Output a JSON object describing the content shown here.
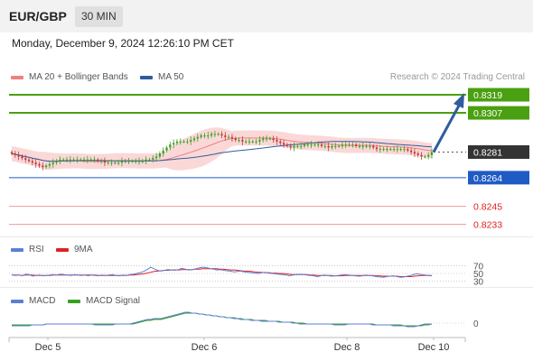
{
  "header": {
    "symbol": "EUR/GBP",
    "timeframe": "30 MIN",
    "datetime": "Monday, December 9, 2024 12:26:10 PM CET",
    "credit": "Research © 2024 Trading Central"
  },
  "legends": {
    "price": [
      {
        "name": "MA 20 + Bollinger Bands",
        "color": "#f08080"
      },
      {
        "name": "MA 50",
        "color": "#2f5d9e"
      }
    ],
    "rsi": [
      {
        "name": "RSI",
        "color": "#5b7fd6"
      },
      {
        "name": "9MA",
        "color": "#e02020"
      }
    ],
    "macd": [
      {
        "name": "MACD",
        "color": "#5b7fd6"
      },
      {
        "name": "MACD Signal",
        "color": "#3aa020"
      }
    ]
  },
  "colors": {
    "bull": "#3aa020",
    "bear": "#c23a3a",
    "band": "#f8c8c8",
    "target_line": "#4aa010",
    "support_line": "#1f5bc4",
    "support2_line": "#f09a9a",
    "current": "#333333",
    "arrow": "#2f5d9e"
  },
  "chart_data": [
    {
      "type": "candlestick",
      "title": "EUR/GBP 30 MIN",
      "x_labels": [
        "Dec 5",
        "Dec 6",
        "Dec 8",
        "Dec 10"
      ],
      "ylim": [
        0.8225,
        0.8325
      ],
      "closes": [
        0.828,
        0.8279,
        0.8278,
        0.8277,
        0.8276,
        0.8275,
        0.8274,
        0.8273,
        0.8272,
        0.8271,
        0.8272,
        0.8273,
        0.8274,
        0.8275,
        0.8276,
        0.8276,
        0.8276,
        0.8276,
        0.8276,
        0.8276,
        0.8276,
        0.8276,
        0.8276,
        0.8276,
        0.8276,
        0.8275,
        0.8275,
        0.8274,
        0.8274,
        0.8274,
        0.8274,
        0.8274,
        0.8275,
        0.8275,
        0.8275,
        0.8275,
        0.8275,
        0.8275,
        0.8275,
        0.8276,
        0.8276,
        0.8277,
        0.8278,
        0.828,
        0.8282,
        0.8284,
        0.8286,
        0.8287,
        0.8288,
        0.8288,
        0.8288,
        0.8288,
        0.8289,
        0.829,
        0.8291,
        0.8292,
        0.8292,
        0.8292,
        0.8293,
        0.8293,
        0.8293,
        0.8292,
        0.8291,
        0.8291,
        0.829,
        0.8289,
        0.8289,
        0.8288,
        0.8288,
        0.8288,
        0.8288,
        0.8288,
        0.8289,
        0.829,
        0.829,
        0.829,
        0.8289,
        0.8288,
        0.8287,
        0.8286,
        0.8285,
        0.8284,
        0.8285,
        0.8285,
        0.8285,
        0.8286,
        0.8286,
        0.8286,
        0.8286,
        0.8286,
        0.8285,
        0.8285,
        0.8284,
        0.8285,
        0.8285,
        0.8285,
        0.8286,
        0.8286,
        0.8286,
        0.8286,
        0.8285,
        0.8285,
        0.8285,
        0.8285,
        0.8285,
        0.8284,
        0.8283,
        0.8283,
        0.8283,
        0.8283,
        0.8283,
        0.8283,
        0.8283,
        0.8283,
        0.8283,
        0.8282,
        0.8281,
        0.828,
        0.8279,
        0.8278,
        0.8278,
        0.8279,
        0.8281
      ],
      "levels": [
        {
          "label": "0.8319",
          "value": 0.8319,
          "kind": "target"
        },
        {
          "label": "0.8307",
          "value": 0.8307,
          "kind": "target"
        },
        {
          "label": "0.8281",
          "value": 0.8281,
          "kind": "current"
        },
        {
          "label": "0.8264",
          "value": 0.8264,
          "kind": "support"
        },
        {
          "label": "0.8245",
          "value": 0.8245,
          "kind": "support2"
        },
        {
          "label": "0.8233",
          "value": 0.8233,
          "kind": "support2"
        }
      ]
    },
    {
      "type": "line",
      "name": "RSI",
      "ticks": [
        "70",
        "50",
        "30"
      ],
      "ylim": [
        20,
        80
      ],
      "rsi": [
        47,
        45,
        46,
        44,
        48,
        47,
        43,
        45,
        46,
        44,
        45,
        46,
        47,
        46,
        48,
        47,
        46,
        45,
        47,
        46,
        45,
        46,
        44,
        46,
        45,
        44,
        46,
        45,
        46,
        47,
        45,
        44,
        46,
        45,
        47,
        48,
        50,
        52,
        55,
        60,
        66,
        62,
        58,
        56,
        58,
        60,
        59,
        58,
        60,
        63,
        61,
        59,
        60,
        62,
        64,
        66,
        65,
        63,
        61,
        59,
        60,
        58,
        57,
        56,
        54,
        55,
        56,
        54,
        53,
        52,
        51,
        50,
        52,
        53,
        51,
        50,
        49,
        48,
        47,
        46,
        44,
        46,
        47,
        48,
        47,
        46,
        45,
        44,
        42,
        44,
        46,
        45,
        43,
        44,
        45,
        46,
        47,
        46,
        45,
        44,
        43,
        44,
        46,
        45,
        44,
        42,
        41,
        40,
        42,
        43,
        44,
        42,
        40,
        41,
        43,
        45,
        48,
        49,
        47,
        46,
        45,
        44
      ],
      "ma9": [
        46,
        46,
        46,
        45,
        46,
        46,
        46,
        45,
        45,
        45,
        45,
        45,
        46,
        46,
        46,
        46,
        46,
        46,
        46,
        46,
        46,
        46,
        46,
        46,
        46,
        45,
        45,
        45,
        45,
        45,
        45,
        45,
        45,
        45,
        46,
        46,
        47,
        48,
        49,
        51,
        53,
        55,
        56,
        57,
        58,
        58,
        59,
        59,
        59,
        60,
        60,
        60,
        60,
        61,
        61,
        62,
        62,
        62,
        62,
        62,
        61,
        61,
        60,
        59,
        59,
        58,
        57,
        56,
        56,
        55,
        54,
        53,
        53,
        52,
        52,
        51,
        51,
        50,
        50,
        49,
        48,
        47,
        47,
        47,
        47,
        47,
        46,
        46,
        45,
        45,
        45,
        45,
        45,
        44,
        44,
        44,
        45,
        45,
        45,
        45,
        45,
        45,
        45,
        45,
        45,
        44,
        44,
        43,
        43,
        43,
        43,
        43,
        42,
        42,
        42,
        42,
        43,
        44,
        45,
        45,
        45,
        45
      ]
    },
    {
      "type": "line",
      "name": "MACD",
      "ticks": [
        "0"
      ],
      "ylim": [
        -0.0012,
        0.0016
      ],
      "macd": [
        -0.0003,
        -0.0003,
        -0.0003,
        -0.0003,
        -0.0003,
        -0.0003,
        -0.0002,
        -0.0002,
        -0.0002,
        -0.0002,
        -0.0001,
        -0.0001,
        -0.0001,
        -0.0001,
        -0.0001,
        -0.0001,
        -0.0001,
        -0.0001,
        -0.0001,
        -0.0001,
        -0.0001,
        -0.0001,
        -0.0001,
        -0.0001,
        -0.0002,
        -0.0002,
        -0.0002,
        -0.0002,
        -0.0002,
        -0.0002,
        -0.0001,
        -0.0001,
        -0.0001,
        -0.0001,
        -0.0001,
        0,
        0.0001,
        0.0002,
        0.0003,
        0.0004,
        0.0004,
        0.0005,
        0.0005,
        0.0005,
        0.0006,
        0.0007,
        0.0008,
        0.0009,
        0.001,
        0.0011,
        0.0012,
        0.0012,
        0.0011,
        0.0011,
        0.001,
        0.001,
        0.0009,
        0.0009,
        0.0008,
        0.0008,
        0.0007,
        0.0007,
        0.0006,
        0.0006,
        0.0005,
        0.0005,
        0.0004,
        0.0004,
        0.0004,
        0.0003,
        0.0003,
        0.0003,
        0.0002,
        0.0002,
        0.0002,
        0.0002,
        0.0002,
        0.0001,
        0.0001,
        0.0001,
        0.0001,
        0,
        0,
        -0.0001,
        -0.0001,
        -0.0001,
        -0.0001,
        -0.0001,
        -0.0001,
        -0.0001,
        -0.0001,
        -0.0001,
        -0.0001,
        -0.0002,
        -0.0002,
        -0.0002,
        -0.0002,
        -0.0001,
        -0.0001,
        -0.0001,
        -0.0001,
        -0.0001,
        -0.0001,
        -0.0001,
        -0.0002,
        -0.0002,
        -0.0002,
        -0.0002,
        -0.0002,
        -0.0002,
        -0.0003,
        -0.0003,
        -0.0003,
        -0.0003,
        -0.0004,
        -0.0004,
        -0.0004,
        -0.0003,
        -0.0002,
        -0.0001,
        -0.0001,
        -0.0001
      ],
      "signal": [
        -0.0002,
        -0.0002,
        -0.0002,
        -0.0002,
        -0.0002,
        -0.0002,
        -0.0002,
        -0.0002,
        -0.0002,
        -0.0002,
        -0.0001,
        -0.0001,
        -0.0001,
        -0.0001,
        -0.0001,
        -0.0001,
        -0.0001,
        -0.0001,
        -0.0001,
        -0.0001,
        -0.0001,
        -0.0001,
        -0.0001,
        -0.0001,
        -0.0001,
        -0.0001,
        -0.0001,
        -0.0001,
        -0.0001,
        -0.0001,
        -0.0001,
        -0.0001,
        -0.0001,
        -0.0001,
        -0.0001,
        -0.0001,
        0,
        0.0001,
        0.0002,
        0.0003,
        0.0003,
        0.0004,
        0.0004,
        0.0004,
        0.0005,
        0.0006,
        0.0007,
        0.0008,
        0.0009,
        0.001,
        0.0011,
        0.0011,
        0.0011,
        0.0011,
        0.001,
        0.001,
        0.0009,
        0.0009,
        0.0008,
        0.0008,
        0.0007,
        0.0007,
        0.0006,
        0.0006,
        0.0006,
        0.0005,
        0.0005,
        0.0004,
        0.0004,
        0.0004,
        0.0003,
        0.0003,
        0.0003,
        0.0003,
        0.0002,
        0.0002,
        0.0002,
        0.0002,
        0.0001,
        0.0001,
        0.0001,
        0.0001,
        0,
        0,
        0,
        -0.0001,
        -0.0001,
        -0.0001,
        -0.0001,
        -0.0001,
        -0.0001,
        -0.0001,
        -0.0001,
        -0.0001,
        -0.0001,
        -0.0001,
        -0.0001,
        -0.0001,
        -0.0001,
        -0.0001,
        -0.0001,
        -0.0001,
        -0.0001,
        -0.0001,
        -0.0001,
        -0.0002,
        -0.0002,
        -0.0002,
        -0.0002,
        -0.0002,
        -0.0002,
        -0.0002,
        -0.0002,
        -0.0003,
        -0.0003,
        -0.0003,
        -0.0003,
        -0.0003,
        -0.0003,
        -0.0002,
        -0.0002,
        -0.0001
      ]
    }
  ]
}
